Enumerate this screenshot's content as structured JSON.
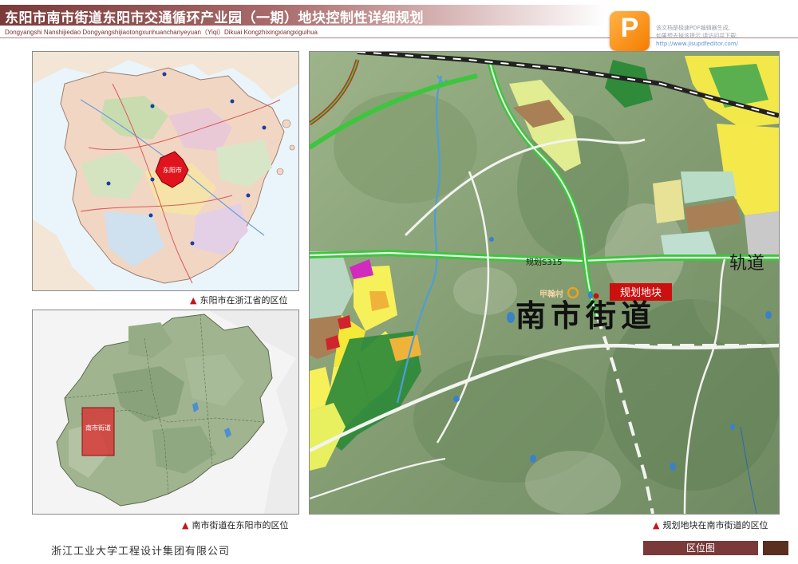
{
  "header": {
    "title": "东阳市南市街道东阳市交通循环产业园（一期）地块控制性详细规划",
    "subtitle": "Dongyangshi Nanshijiedao Dongyangshijiaotongxunhuanchanyeyuan（Yiqi）Dikuai Kongzhixingxiangxiguihua",
    "logo_glyph": "P",
    "notice_lines": [
      "该文档是极速PDF编辑器生成,",
      "如果想去掉该提示,请访问并下载:",
      "http://www.jisupdfeditor.com/"
    ]
  },
  "map1": {
    "highlight_label": "东阳市",
    "caption": "东阳市在浙江省的区位",
    "highlight_color": "#e0141e"
  },
  "map2": {
    "highlight_label": "南市街道",
    "caption": "南市街道在东阳市的区位",
    "highlight_color": "#d63a3a"
  },
  "map3": {
    "road_label": "规划S315",
    "rail_label": "轨道",
    "village_label": "甲翰村",
    "site_label": "规划地块",
    "district_label": "南市街道",
    "caption": "规划地块在南市街道的区位",
    "site_color": "#cc1010"
  },
  "footer": {
    "company": "浙江工业大学工程设计集团有限公司",
    "tag": "区位图"
  },
  "colors": {
    "brand": "#7a3a3a",
    "accent_red": "#c0161c",
    "road_green": "#3ec53e"
  },
  "icons": {
    "caption_marker": "▲"
  }
}
